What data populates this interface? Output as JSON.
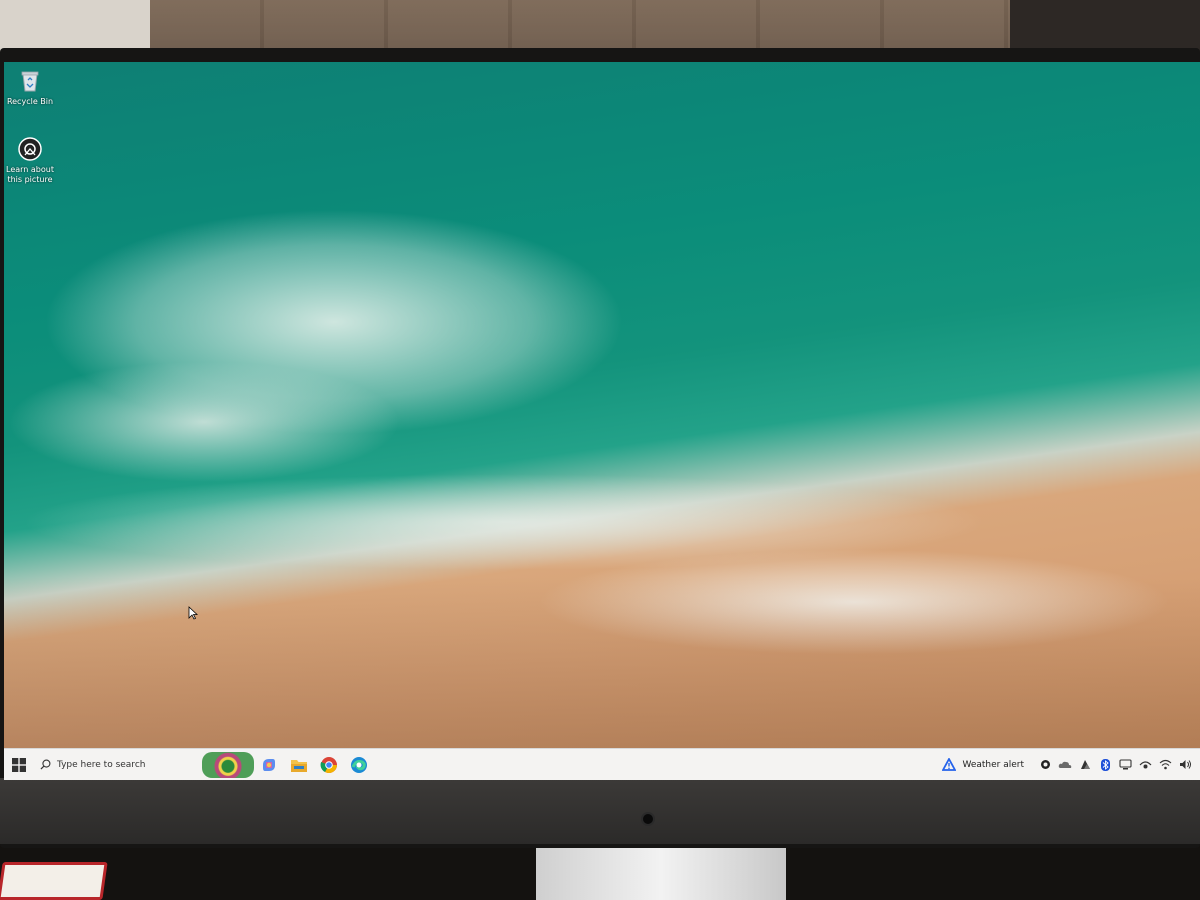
{
  "desktop": {
    "icons": [
      {
        "label": "Recycle Bin",
        "icon": "recycle-bin-icon"
      },
      {
        "label": "Learn about this picture",
        "icon": "camera-info-icon"
      }
    ]
  },
  "taskbar": {
    "search_placeholder": "Type here to search",
    "pinned_apps": [
      "copilot-icon",
      "file-explorer-icon",
      "chrome-icon",
      "edge-icon"
    ],
    "weather": {
      "text": "Weather alert",
      "icon": "weather-alert-icon"
    },
    "tray_icons": [
      "copilot-tray-icon",
      "onedrive-icon",
      "app-tray-icon",
      "bluetooth-icon",
      "network-device-icon",
      "vpn-icon",
      "wifi-icon",
      "volume-icon"
    ]
  },
  "colors": {
    "taskbar_bg": "#f4f3f2",
    "edge_blue": "#1b8ad4",
    "alert_blue": "#2563eb"
  }
}
